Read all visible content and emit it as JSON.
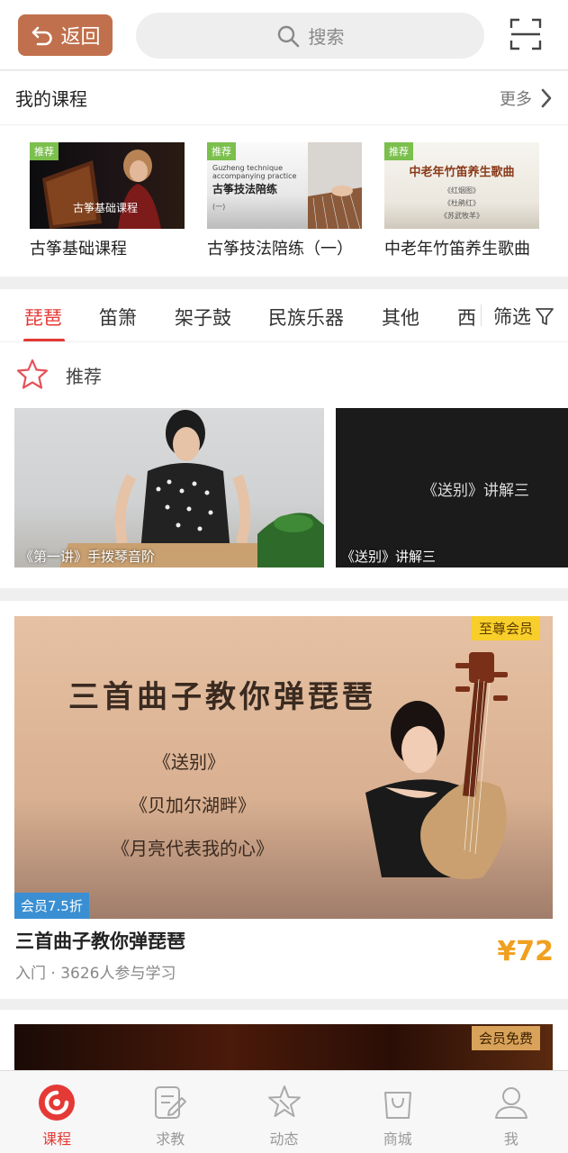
{
  "header": {
    "back_label": "返回",
    "search_placeholder": "搜索",
    "back_color": "#c0704c"
  },
  "my_courses": {
    "title": "我的课程",
    "more_label": "更多",
    "items": [
      {
        "name": "古筝基础课程",
        "tag": "推荐",
        "overlay": "古筝基础课程"
      },
      {
        "name": "古筝技法陪练（一）",
        "tag": "推荐",
        "overlay_line1": "Guzheng technique",
        "overlay_line2": "accompanying practice",
        "overlay_title": "古筝技法陪练",
        "overlay_sub": "(一)"
      },
      {
        "name": "中老年竹笛养生歌曲",
        "tag": "推荐",
        "overlay_title": "中老年竹笛养生歌曲",
        "overlay_songs": [
          "《红烟图》",
          "《杜鹃红》",
          "《苏武牧羊》"
        ]
      }
    ]
  },
  "tabs": {
    "items": [
      "琵琶",
      "笛箫",
      "架子鼓",
      "民族乐器",
      "其他",
      "西"
    ],
    "active_index": 0,
    "filter_label": "筛选",
    "active_color": "#e53935"
  },
  "recommend": {
    "title": "推荐",
    "items": [
      {
        "caption": "《第一讲》手拨琴音阶"
      },
      {
        "caption": "《送别》讲解三",
        "overlay_text": "《送别》讲解三"
      }
    ]
  },
  "course": {
    "vip_badge": "至尊会员",
    "discount": "会员7.5折",
    "poster_title": "三首曲子教你弹琵琶",
    "poster_songs": [
      "《送别》",
      "《贝加尔湖畔》",
      "《月亮代表我的心》"
    ],
    "title": "三首曲子教你弹琵琶",
    "meta": "入门 · 3626人参与学习",
    "price": "¥72",
    "price_color": "#f0a020"
  },
  "course2": {
    "vip_badge": "会员免费"
  },
  "bottom_nav": {
    "items": [
      {
        "label": "课程",
        "icon": "course-icon",
        "active": true
      },
      {
        "label": "求教",
        "icon": "ask-icon",
        "active": false
      },
      {
        "label": "动态",
        "icon": "feed-icon",
        "active": false
      },
      {
        "label": "商城",
        "icon": "shop-icon",
        "active": false
      },
      {
        "label": "我",
        "icon": "profile-icon",
        "active": false
      }
    ]
  }
}
